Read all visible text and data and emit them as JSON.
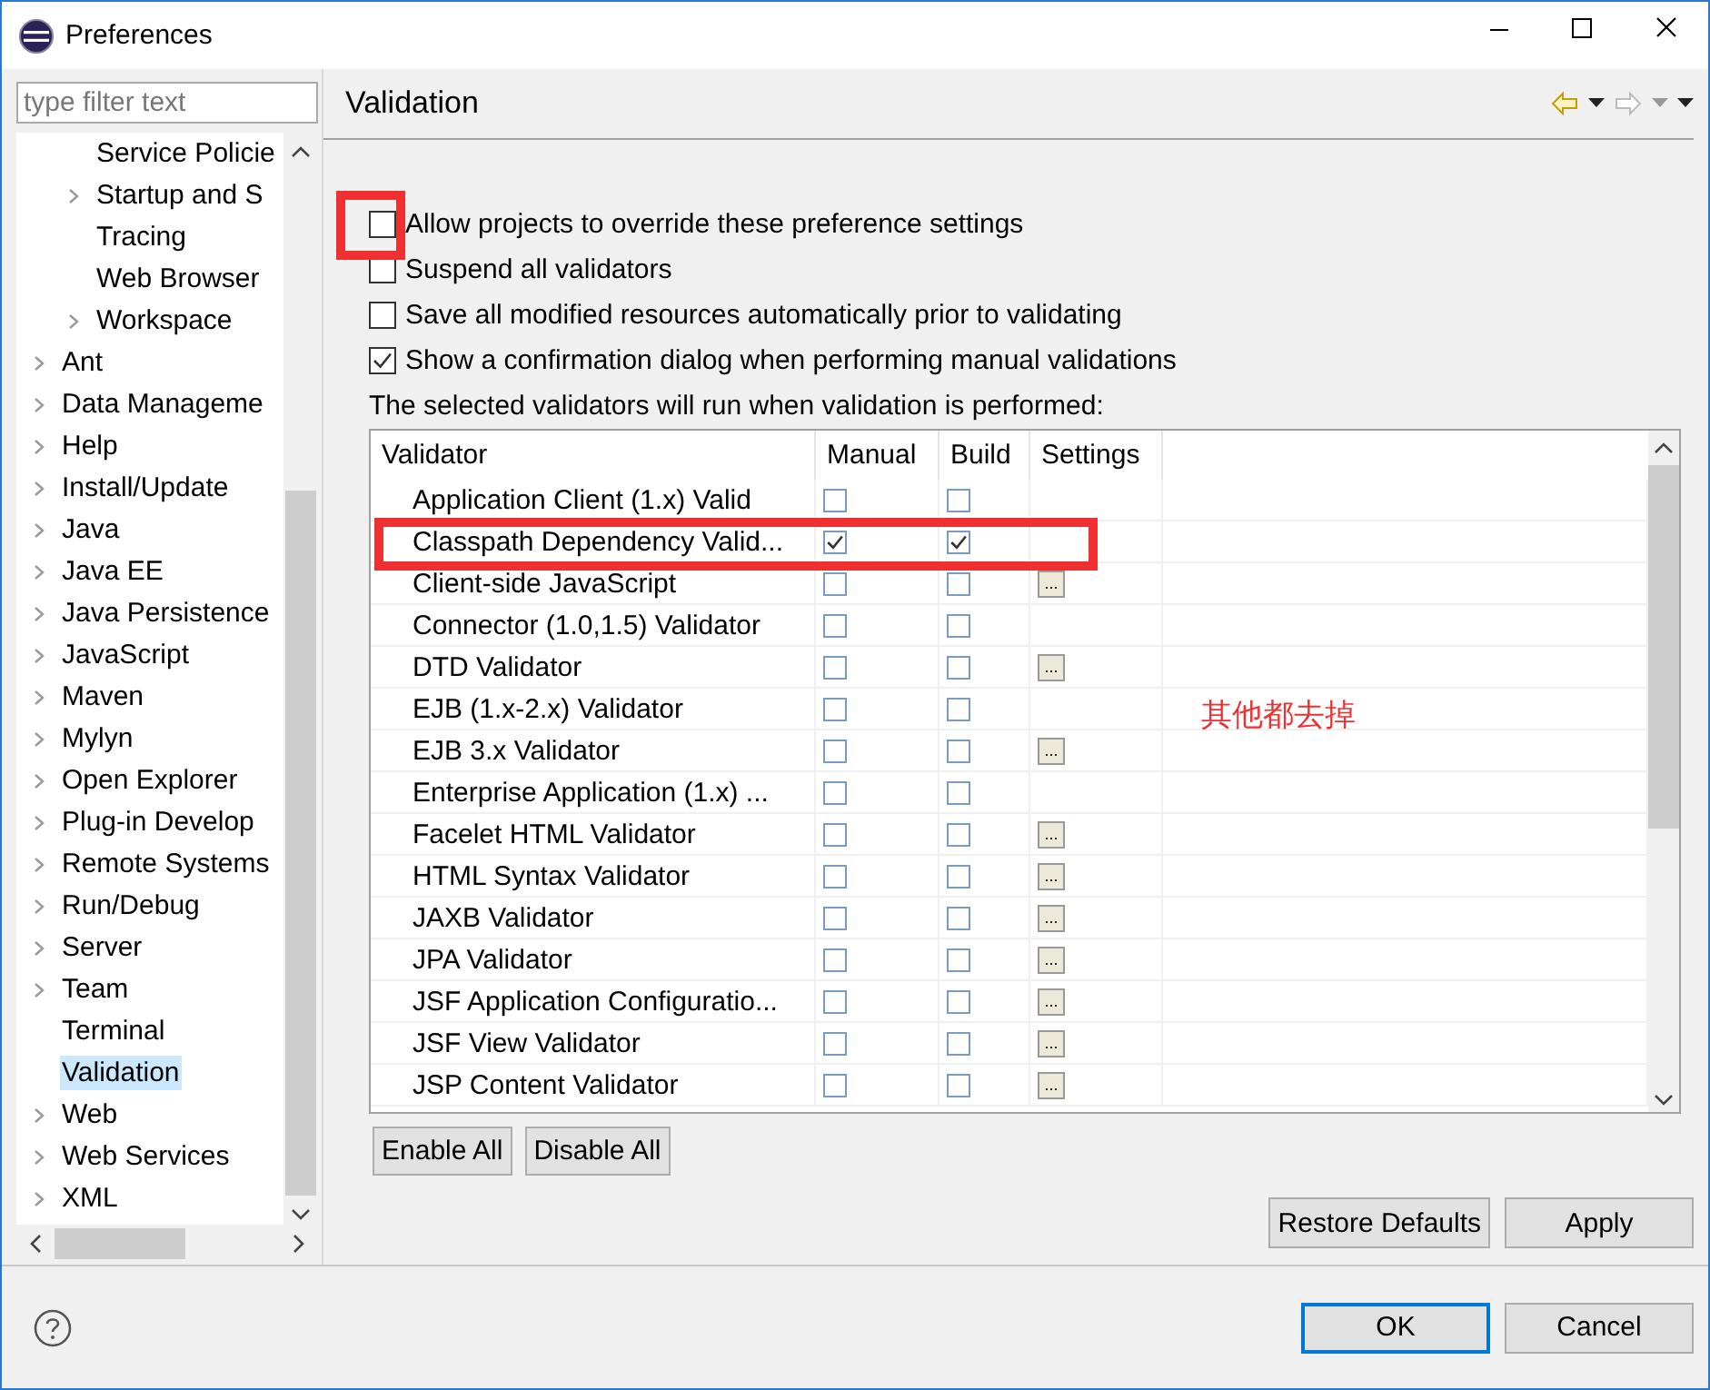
{
  "window": {
    "title": "Preferences"
  },
  "filter": {
    "placeholder": "type filter text"
  },
  "tree": {
    "continued_children": [
      {
        "label": "Service Policie",
        "expandable": false,
        "selected": false
      },
      {
        "label": "Startup and S",
        "expandable": true,
        "selected": false
      },
      {
        "label": "Tracing",
        "expandable": false,
        "selected": false
      },
      {
        "label": "Web Browser",
        "expandable": false,
        "selected": false
      },
      {
        "label": "Workspace",
        "expandable": true,
        "selected": false
      }
    ],
    "items": [
      {
        "label": "Ant",
        "expandable": true,
        "selected": false
      },
      {
        "label": "Data Manageme",
        "expandable": true,
        "selected": false
      },
      {
        "label": "Help",
        "expandable": true,
        "selected": false
      },
      {
        "label": "Install/Update",
        "expandable": true,
        "selected": false
      },
      {
        "label": "Java",
        "expandable": true,
        "selected": false
      },
      {
        "label": "Java EE",
        "expandable": true,
        "selected": false
      },
      {
        "label": "Java Persistence",
        "expandable": true,
        "selected": false
      },
      {
        "label": "JavaScript",
        "expandable": true,
        "selected": false
      },
      {
        "label": "Maven",
        "expandable": true,
        "selected": false
      },
      {
        "label": "Mylyn",
        "expandable": true,
        "selected": false
      },
      {
        "label": "Open Explorer",
        "expandable": true,
        "selected": false
      },
      {
        "label": "Plug-in Develop",
        "expandable": true,
        "selected": false
      },
      {
        "label": "Remote Systems",
        "expandable": true,
        "selected": false
      },
      {
        "label": "Run/Debug",
        "expandable": true,
        "selected": false
      },
      {
        "label": "Server",
        "expandable": true,
        "selected": false
      },
      {
        "label": "Team",
        "expandable": true,
        "selected": false
      },
      {
        "label": "Terminal",
        "expandable": false,
        "selected": false
      },
      {
        "label": "Validation",
        "expandable": false,
        "selected": true
      },
      {
        "label": "Web",
        "expandable": true,
        "selected": false
      },
      {
        "label": "Web Services",
        "expandable": true,
        "selected": false
      },
      {
        "label": "XML",
        "expandable": true,
        "selected": false
      }
    ]
  },
  "page": {
    "title": "Validation"
  },
  "options": [
    {
      "label": "Allow projects to override these preference settings",
      "checked": false
    },
    {
      "label": "Suspend all validators",
      "checked": false
    },
    {
      "label": "Save all modified resources automatically prior to validating",
      "checked": false
    },
    {
      "label": "Show a confirmation dialog when performing manual validations",
      "checked": true
    }
  ],
  "table_caption": "The selected validators will run when validation is performed:",
  "table": {
    "columns": [
      "Validator",
      "Manual",
      "Build",
      "Settings"
    ],
    "rows": [
      {
        "name": "Application Client (1.x) Valid",
        "manual": false,
        "build": false
      },
      {
        "name": "Classpath Dependency Valid...",
        "manual": true,
        "build": true
      },
      {
        "name": "Client-side JavaScript",
        "manual": false,
        "build": false,
        "settings": "..."
      },
      {
        "name": "Connector (1.0,1.5) Validator",
        "manual": false,
        "build": false
      },
      {
        "name": "DTD Validator",
        "manual": false,
        "build": false,
        "settings": "..."
      },
      {
        "name": "EJB (1.x-2.x) Validator",
        "manual": false,
        "build": false
      },
      {
        "name": "EJB 3.x Validator",
        "manual": false,
        "build": false,
        "settings": "..."
      },
      {
        "name": "Enterprise Application (1.x) ...",
        "manual": false,
        "build": false
      },
      {
        "name": "Facelet HTML Validator",
        "manual": false,
        "build": false,
        "settings": "..."
      },
      {
        "name": "HTML Syntax Validator",
        "manual": false,
        "build": false,
        "settings": "..."
      },
      {
        "name": "JAXB Validator",
        "manual": false,
        "build": false,
        "settings": "..."
      },
      {
        "name": "JPA Validator",
        "manual": false,
        "build": false,
        "settings": "..."
      },
      {
        "name": "JSF Application Configuratio...",
        "manual": false,
        "build": false,
        "settings": "..."
      },
      {
        "name": "JSF View Validator",
        "manual": false,
        "build": false,
        "settings": "..."
      },
      {
        "name": "JSP Content Validator",
        "manual": false,
        "build": false,
        "settings": "..."
      }
    ]
  },
  "table_buttons": [
    "Enable All",
    "Disable All"
  ],
  "page_buttons": [
    "Restore Defaults",
    "Apply"
  ],
  "dialog_buttons": [
    {
      "label": "OK",
      "default": true
    },
    {
      "label": "Cancel",
      "default": false
    }
  ],
  "annotation": {
    "note": "其他都去掉"
  }
}
